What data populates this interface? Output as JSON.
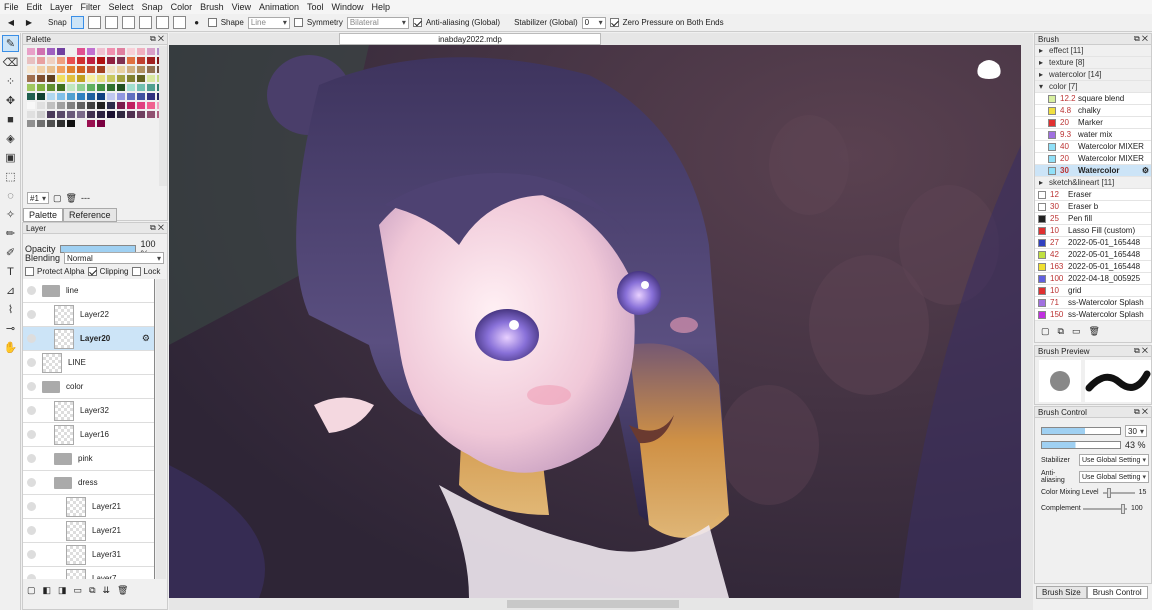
{
  "menu": [
    "File",
    "Edit",
    "Layer",
    "Filter",
    "Select",
    "Snap",
    "Color",
    "Brush",
    "View",
    "Animation",
    "Tool",
    "Window",
    "Help"
  ],
  "toolopts": {
    "snap_label": "Snap",
    "shape_label": "Shape",
    "shape_value": "Line",
    "symmetry_label": "Symmetry",
    "symmetry_value": "Bilateral",
    "antialias_label": "Anti-aliasing (Global)",
    "stabilizer_label": "Stabilizer (Global)",
    "stabilizer_value": "0",
    "zero_pressure_label": "Zero Pressure on Both Ends"
  },
  "palette": {
    "title": "Palette",
    "set_value": "#1",
    "more_label": "---",
    "tabs": [
      "Palette",
      "Reference"
    ],
    "swatches": [
      "#e8a0c8",
      "#d070b0",
      "#a060c0",
      "#7040a0",
      "#f0f0f0",
      "#e05090",
      "#c070d0",
      "#f0c0d0",
      "#f090b0",
      "#e080a0",
      "#f8d0d8",
      "#f0b0c0",
      "#d8a0c8",
      "#b090c8",
      "#e8c0c0",
      "#e8a0a0",
      "#f0d0c0",
      "#f0a080",
      "#e85050",
      "#d03030",
      "#c02040",
      "#b01010",
      "#902040",
      "#803050",
      "#e07040",
      "#c04030",
      "#a02020",
      "#801010",
      "#f8e8d0",
      "#f0d0a8",
      "#e8c090",
      "#f0a060",
      "#e08030",
      "#d06020",
      "#c05030",
      "#a04020",
      "#f0e0c0",
      "#e8d0a0",
      "#d0b080",
      "#b09060",
      "#907050",
      "#705040",
      "#a07050",
      "#805030",
      "#604020",
      "#f0e060",
      "#e0c040",
      "#c0a020",
      "#f8f0a0",
      "#e8e080",
      "#c8c860",
      "#a0a040",
      "#808030",
      "#606020",
      "#d8e8a0",
      "#c0d880",
      "#a0c860",
      "#80b040",
      "#609030",
      "#407020",
      "#c0e8c0",
      "#90d090",
      "#60b060",
      "#409040",
      "#307030",
      "#205020",
      "#a0e0d0",
      "#70c0b0",
      "#50a090",
      "#308070",
      "#206050",
      "#104030",
      "#b0d8f0",
      "#80c0e8",
      "#50a0d0",
      "#3080c0",
      "#2060a0",
      "#104080",
      "#c0c8f0",
      "#9098e0",
      "#6070c0",
      "#4050a0",
      "#303080",
      "#202060",
      "#f8f8f8",
      "#e0e0e0",
      "#c0c0c0",
      "#a0a0a0",
      "#808080",
      "#606060",
      "#404040",
      "#202020",
      "#2c2c4a",
      "#7c1c4c",
      "#c02060",
      "#e04080",
      "#f06090",
      "#f0a0c0",
      "#e0e0e0",
      "#d0d0d0",
      "#4a3a5a",
      "#5a4a6a",
      "#6a5a7a",
      "#7a6a8a",
      "#403050",
      "#2a2040",
      "#1a1030",
      "#302840",
      "#503050",
      "#704060",
      "#905070",
      "#b06080",
      "#909090",
      "#707070",
      "#505050",
      "#303030",
      "#101010",
      "#f0f0f0",
      "#9a1050",
      "#7a0040",
      "#f0f0f0",
      "#f0f0f0",
      "#f0f0f0",
      "#f0f0f0",
      "#f0f0f0",
      "#f0f0f0"
    ]
  },
  "layer": {
    "title": "Layer",
    "opacity_label": "Opacity",
    "opacity_value": "100 %",
    "opacity_level": 1.0,
    "blending_label": "Blending",
    "blending_value": "Normal",
    "protect_alpha": "Protect Alpha",
    "clipping": "Clipping",
    "lock": "Lock",
    "rows": [
      {
        "name": "line",
        "type": "folder",
        "indent": 0
      },
      {
        "name": "Layer22",
        "type": "layer",
        "indent": 1
      },
      {
        "name": "Layer20",
        "type": "layer",
        "indent": 1,
        "selected": true
      },
      {
        "name": "LINE",
        "type": "layer",
        "indent": 0
      },
      {
        "name": "color",
        "type": "folder",
        "indent": 0
      },
      {
        "name": "Layer32",
        "type": "layer",
        "indent": 1
      },
      {
        "name": "Layer16",
        "type": "layer",
        "indent": 1
      },
      {
        "name": "pink",
        "type": "folder",
        "indent": 1
      },
      {
        "name": "dress",
        "type": "folder",
        "indent": 1
      },
      {
        "name": "Layer21",
        "type": "layer",
        "indent": 2
      },
      {
        "name": "Layer21",
        "type": "layer",
        "indent": 2
      },
      {
        "name": "Layer31",
        "type": "layer",
        "indent": 2
      },
      {
        "name": "Layer7",
        "type": "layer",
        "indent": 2
      }
    ]
  },
  "canvas": {
    "tab": "inabday2022.mdp"
  },
  "brush": {
    "title": "Brush",
    "items": [
      {
        "type": "group",
        "label": "effect [11]",
        "open": false
      },
      {
        "type": "group",
        "label": "texture [8]",
        "open": false
      },
      {
        "type": "group",
        "label": "watercolor [14]",
        "open": false
      },
      {
        "type": "group",
        "label": "color [7]",
        "open": true
      },
      {
        "type": "brush",
        "size": "12.2",
        "name": "square blend",
        "color": "#d8f0a0",
        "indent": true
      },
      {
        "type": "brush",
        "size": "4.8",
        "name": "chalky",
        "color": "#f0e040",
        "indent": true
      },
      {
        "type": "brush",
        "size": "20",
        "name": "Marker",
        "color": "#e03030",
        "indent": true
      },
      {
        "type": "brush",
        "size": "9.3",
        "name": "water mix",
        "color": "#a070e0",
        "indent": true
      },
      {
        "type": "brush",
        "size": "40",
        "name": "Watercolor MIXER",
        "color": "#90e0f8",
        "indent": true
      },
      {
        "type": "brush",
        "size": "20",
        "name": "Watercolor MIXER",
        "color": "#90e0f8",
        "indent": true
      },
      {
        "type": "brush",
        "size": "30",
        "name": "Watercolor",
        "color": "#90e0f8",
        "indent": true,
        "selected": true
      },
      {
        "type": "group",
        "label": "sketch&lineart [11]",
        "open": false
      },
      {
        "type": "brush",
        "size": "12",
        "name": "Eraser",
        "color": "#ffffff"
      },
      {
        "type": "brush",
        "size": "30",
        "name": "Eraser b",
        "color": "#ffffff"
      },
      {
        "type": "brush",
        "size": "25",
        "name": "Pen fill",
        "color": "#202020"
      },
      {
        "type": "brush",
        "size": "10",
        "name": "Lasso Fill (custom)",
        "color": "#e03030"
      },
      {
        "type": "brush",
        "size": "27",
        "name": "2022-05-01_165448",
        "color": "#3040c0"
      },
      {
        "type": "brush",
        "size": "42",
        "name": "2022-05-01_165448",
        "color": "#c0e040"
      },
      {
        "type": "brush",
        "size": "163",
        "name": "2022-05-01_165448",
        "color": "#f0e030"
      },
      {
        "type": "brush",
        "size": "100",
        "name": "2022-04-18_005925",
        "color": "#6060e0"
      },
      {
        "type": "brush",
        "size": "10",
        "name": "grid",
        "color": "#e03030"
      },
      {
        "type": "brush",
        "size": "71",
        "name": "ss-Watercolor Splash",
        "color": "#a070e0"
      },
      {
        "type": "brush",
        "size": "150",
        "name": "ss-Watercolor Splash",
        "color": "#c030e0"
      }
    ]
  },
  "brush_preview": {
    "title": "Brush Preview"
  },
  "brush_control": {
    "title": "Brush Control",
    "size_value": "30",
    "size_level": 0.55,
    "opacity_value": "43 %",
    "opacity_level": 0.43,
    "stabilizer_label": "Stabilizer",
    "stabilizer_value": "Use Global Setting",
    "antialias_label": "Anti-aliasing",
    "antialias_value": "Use Global Setting",
    "mixing_label": "Color Mixing Level",
    "mixing_value": "15",
    "complement_label": "Complement",
    "complement_value": "100"
  },
  "bottom_tabs": [
    "Brush Size",
    "Brush Control"
  ],
  "colors": {
    "accent": "#3a8ee6",
    "selection": "#cce4f7"
  }
}
